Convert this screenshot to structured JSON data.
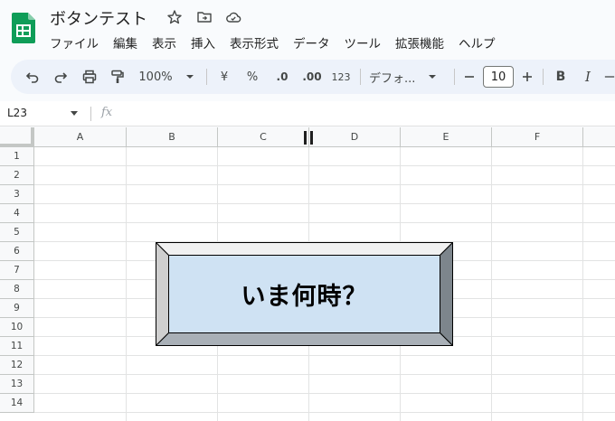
{
  "doc": {
    "title": "ボタンテスト"
  },
  "menu": [
    "ファイル",
    "編集",
    "表示",
    "挿入",
    "表示形式",
    "データ",
    "ツール",
    "拡張機能",
    "ヘルプ"
  ],
  "toolbar": {
    "zoom": "100%",
    "currency": "¥",
    "percent": "%",
    "decrease_decimal": ".0",
    "increase_decimal": ".00",
    "number_format": "123",
    "font": "デフォ...",
    "font_size": "10",
    "bold": "B",
    "italic": "I"
  },
  "formula_bar": {
    "name_box": "L23",
    "fx": "fx"
  },
  "columns": [
    "A",
    "B",
    "C",
    "D",
    "E",
    "F"
  ],
  "rows": [
    "1",
    "2",
    "3",
    "4",
    "5",
    "6",
    "7",
    "8",
    "9",
    "10",
    "11",
    "12",
    "13",
    "14"
  ],
  "drawing": {
    "label": "いま何時？",
    "face_color": "#cfe2f3"
  },
  "colors": {
    "accent": "#0b57d0",
    "sheets_green": "#0f9d58"
  }
}
